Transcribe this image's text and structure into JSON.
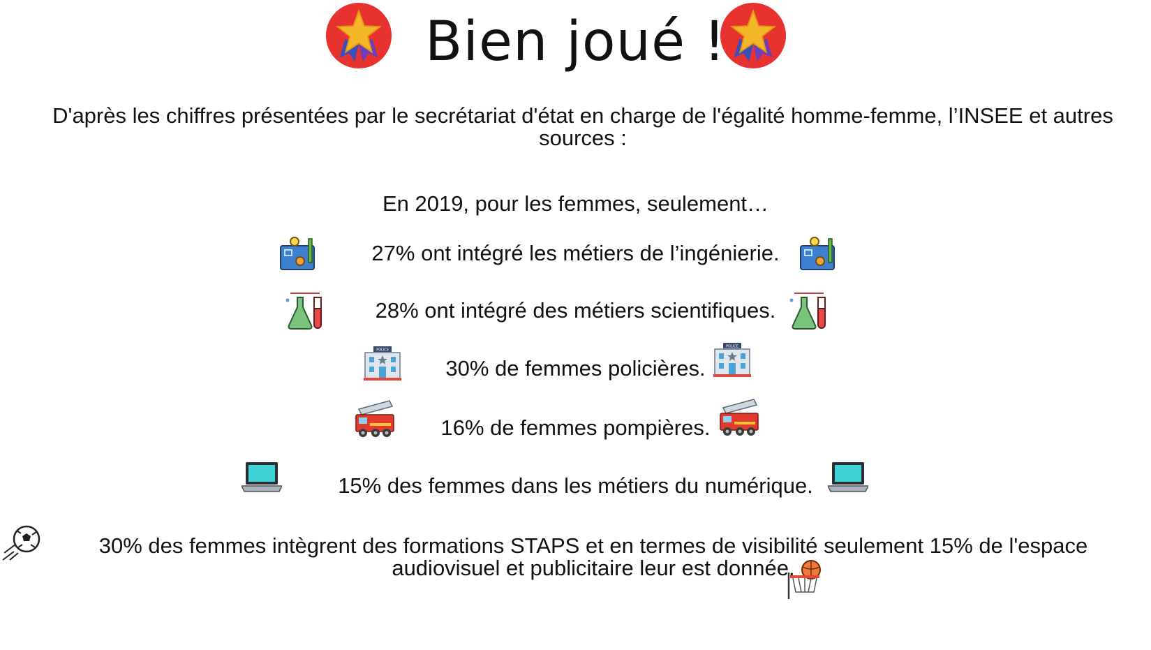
{
  "title": "Bien joué !",
  "intro": "D'après les chiffres présentées par le secrétariat d'état en charge de l'égalité homme-femme, l’INSEE et autres sources :",
  "lead": "En 2019, pour les femmes, seulement…",
  "stats": [
    {
      "text": "27% ont intégré les métiers de l’ingénierie.",
      "icon": "engineering-blueprint-icon"
    },
    {
      "text": "28% ont intégré des métiers scientifiques.",
      "icon": "science-lab-flask-icon"
    },
    {
      "text": "30% de femmes policières.",
      "icon": "police-station-icon"
    },
    {
      "text": "16% de femmes pompières.",
      "icon": "fire-truck-icon"
    },
    {
      "text": "15% des femmes dans les métiers du numérique.",
      "icon": "laptop-icon"
    }
  ],
  "final": "30% des femmes intègrent des formations STAPS et en termes de visibilité seulement 15% de l'espace audiovisuel et publicitaire leur est donnée.",
  "police_sign": "POLICE",
  "icons": {
    "badge": "star-medal-icon",
    "final_left": "soccer-ball-icon",
    "final_right": "basketball-hoop-icon"
  },
  "colors": {
    "badge_red": "#e8322f",
    "badge_star": "#f5b72a",
    "text": "#111111"
  }
}
